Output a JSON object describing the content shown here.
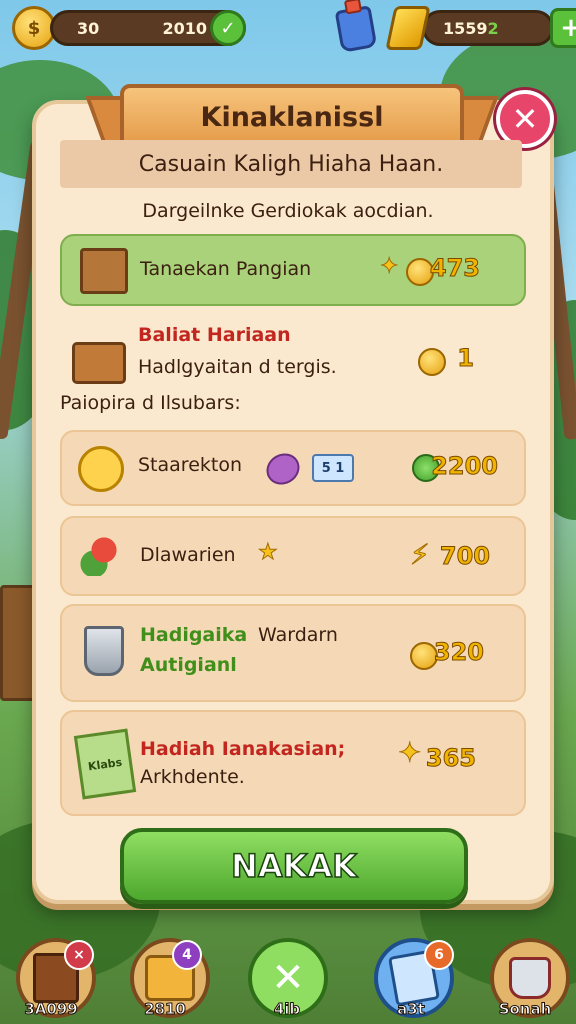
{
  "hud": {
    "coins_left": "30",
    "coins_right": "2010",
    "gems": "1559",
    "gems_suffix": "2"
  },
  "dialog": {
    "title": "Kinaklanissl",
    "subtitle": "Casuain Kaligh Hiaha Haan.",
    "description": "Dargeilnke Gerdiokak aocdian.",
    "section_label": "Paiopira d Ilsubars:",
    "confirm_label": "NAKAK"
  },
  "rewards": [
    {
      "title": "Tanaekan Pangian",
      "amount": "473"
    },
    {
      "title": "Baliat Hariaan",
      "subtitle": "Hadlgyaitan d tergis.",
      "amount": "1"
    },
    {
      "title": "Staarekton",
      "ticket": "5 1",
      "amount": "2200"
    },
    {
      "title": "Dlawarien",
      "amount": "700"
    },
    {
      "title": "Hadigaika",
      "title_suffix": "Wardarn",
      "subtitle": "Autigianl",
      "amount": "320"
    },
    {
      "title": "Hadiah Ianakasian;",
      "subtitle": "Arkhdente.",
      "amount": "365",
      "icon_text": "Klabs"
    }
  ],
  "bottom_nav": [
    {
      "label": "3A099",
      "badge": "×",
      "icon": "book-icon"
    },
    {
      "label": "2810",
      "badge": "4",
      "icon": "chest-icon"
    },
    {
      "label": "4ib",
      "icon": "sword-icon"
    },
    {
      "label": "a3t",
      "badge": "6",
      "icon": "card-icon"
    },
    {
      "label": "Sonah",
      "icon": "pot-icon"
    }
  ],
  "colors": {
    "panel": "#fbe9cf",
    "highlight_row": "#a9d27a",
    "confirm_button": "#4da82d",
    "close_button": "#e8456a",
    "reward_amount": "#f0b400"
  }
}
